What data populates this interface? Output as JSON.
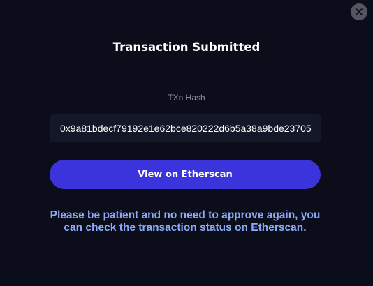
{
  "modal": {
    "title": "Transaction Submitted",
    "close_icon": "close-icon",
    "hash_label": "TXn Hash",
    "hash_value": "0x9a81bdecf79192e1e62bce820222d6b5a38a9bde23705",
    "view_button_label": "View on Etherscan",
    "notice": "Please be patient and no need to approve again, you can check the transaction status on Etherscan."
  },
  "colors": {
    "background": "#0b0d1b",
    "field_background": "#141728",
    "accent_button": "#3b34dc",
    "notice_text": "#8ca8f8",
    "muted_text": "#8b8e9b",
    "close_button": "#535560"
  }
}
